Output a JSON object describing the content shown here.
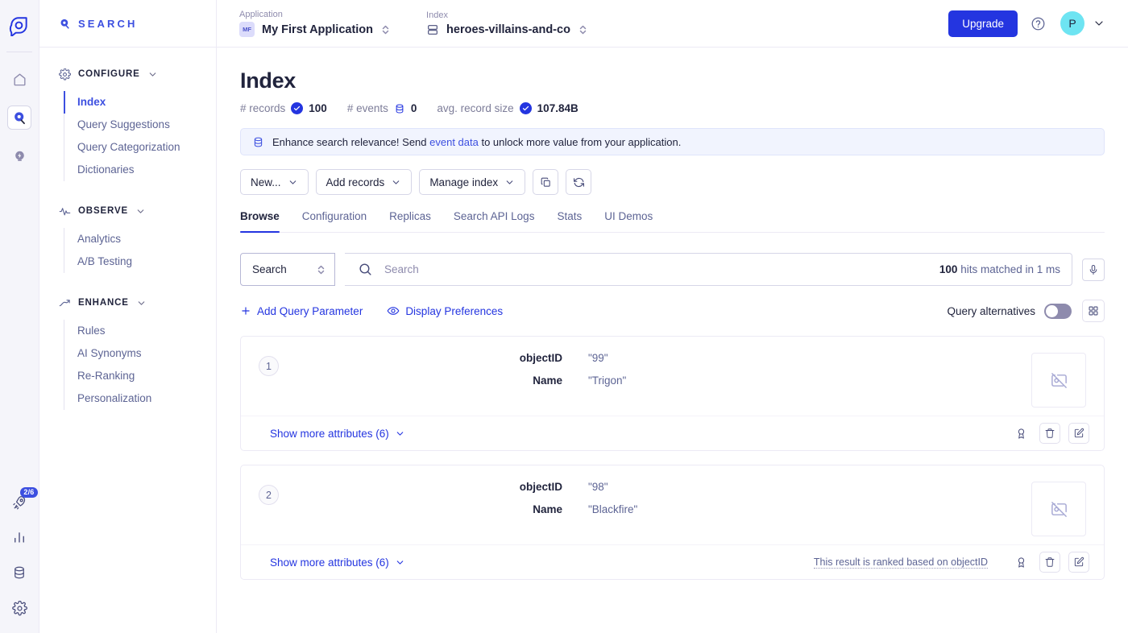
{
  "rail": {
    "logo_icon": "algolia-logo-icon",
    "items": [
      {
        "icon": "home-icon",
        "name": "home",
        "active": false
      },
      {
        "icon": "search-pin-icon",
        "name": "search",
        "active": true
      },
      {
        "icon": "lightning-pin-icon",
        "name": "accelerate",
        "active": false
      }
    ],
    "bottom_items": [
      {
        "icon": "rocket-icon",
        "name": "onboarding",
        "badge": "2/6"
      },
      {
        "icon": "bar-chart-icon",
        "name": "usage",
        "badge": ""
      },
      {
        "icon": "database-icon",
        "name": "data-sources",
        "badge": ""
      },
      {
        "icon": "gear-icon",
        "name": "settings",
        "badge": ""
      }
    ]
  },
  "sidebar": {
    "product_label": "SEARCH",
    "product_icon": "search-pin-icon",
    "sections": [
      {
        "label": "CONFIGURE",
        "icon": "gear-icon",
        "items": [
          {
            "label": "Index",
            "active": true
          },
          {
            "label": "Query Suggestions",
            "active": false
          },
          {
            "label": "Query Categorization",
            "active": false
          },
          {
            "label": "Dictionaries",
            "active": false
          }
        ]
      },
      {
        "label": "OBSERVE",
        "icon": "pulse-icon",
        "items": [
          {
            "label": "Analytics",
            "active": false
          },
          {
            "label": "A/B Testing",
            "active": false
          }
        ]
      },
      {
        "label": "ENHANCE",
        "icon": "trend-up-icon",
        "items": [
          {
            "label": "Rules",
            "active": false
          },
          {
            "label": "AI Synonyms",
            "active": false
          },
          {
            "label": "Re-Ranking",
            "active": false
          },
          {
            "label": "Personalization",
            "active": false
          }
        ]
      }
    ]
  },
  "topbar": {
    "application": {
      "label": "Application",
      "value": "My First Application",
      "initials": "MF"
    },
    "index": {
      "label": "Index",
      "value": "heroes-villains-and-co"
    },
    "upgrade_label": "Upgrade",
    "help_icon": "question-circle-icon",
    "avatar_initial": "P"
  },
  "page": {
    "title": "Index",
    "stats": [
      {
        "label": "# records",
        "icon": "check-circle-icon",
        "value": "100"
      },
      {
        "label": "# events",
        "icon": "database-icon",
        "value": "0"
      },
      {
        "label": "avg. record size",
        "icon": "check-circle-icon",
        "value": "107.84B"
      }
    ],
    "banner": {
      "icon": "database-icon",
      "text_before": "Enhance search relevance! Send ",
      "link": "event data",
      "text_after": " to unlock more value from your application."
    },
    "toolbar": [
      {
        "label": "New...",
        "caret": true,
        "name": "new-button"
      },
      {
        "label": "Add records",
        "caret": true,
        "name": "add-records-button"
      },
      {
        "label": "Manage index",
        "caret": true,
        "name": "manage-index-button"
      }
    ],
    "toolbar_icons": [
      {
        "icon": "copy-icon",
        "name": "copy-index-button"
      },
      {
        "icon": "refresh-icon",
        "name": "refresh-button"
      }
    ],
    "tabs": [
      {
        "label": "Browse",
        "active": true
      },
      {
        "label": "Configuration",
        "active": false
      },
      {
        "label": "Replicas",
        "active": false
      },
      {
        "label": "Search API Logs",
        "active": false
      },
      {
        "label": "Stats",
        "active": false
      },
      {
        "label": "UI Demos",
        "active": false
      }
    ],
    "search": {
      "parameter_label": "Search",
      "placeholder": "Search",
      "hits_count": "100",
      "hits_text": "hits matched in 1 ms",
      "mic_icon": "microphone-icon"
    },
    "options": {
      "add_query_parameter": "Add Query Parameter",
      "display_preferences": "Display Preferences",
      "query_alternatives_label": "Query alternatives",
      "query_alternatives_on": false,
      "grid_view_icon": "grid-view-icon"
    },
    "records": [
      {
        "rank": "1",
        "attributes": [
          {
            "key": "objectID",
            "value": "\"99\""
          },
          {
            "key": "Name",
            "value": "\"Trigon\""
          }
        ],
        "thumb_icon": "image-off-icon",
        "show_more_label": "Show more attributes (6)",
        "rank_note": "",
        "actions": [
          {
            "icon": "award-icon",
            "name": "promote-record-button",
            "boxed": false
          },
          {
            "icon": "trash-icon",
            "name": "delete-record-button",
            "boxed": true
          },
          {
            "icon": "edit-icon",
            "name": "edit-record-button",
            "boxed": true
          }
        ]
      },
      {
        "rank": "2",
        "attributes": [
          {
            "key": "objectID",
            "value": "\"98\""
          },
          {
            "key": "Name",
            "value": "\"Blackfire\""
          }
        ],
        "thumb_icon": "image-off-icon",
        "show_more_label": "Show more attributes (6)",
        "rank_note": "This result is ranked based on objectID",
        "actions": [
          {
            "icon": "award-icon",
            "name": "promote-record-button",
            "boxed": false
          },
          {
            "icon": "trash-icon",
            "name": "delete-record-button",
            "boxed": true
          },
          {
            "icon": "edit-icon",
            "name": "edit-record-button",
            "boxed": true
          }
        ]
      }
    ]
  },
  "colors": {
    "accent": "#2435e0",
    "brand": "#3c4fe0",
    "text": "#21243d",
    "muted": "#5d6494",
    "border": "#eceaf5",
    "avatar": "#6ee4f2"
  }
}
